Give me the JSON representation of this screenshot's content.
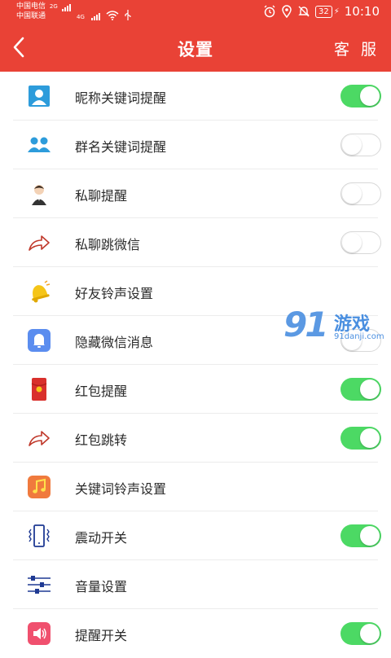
{
  "status": {
    "carrier1": "中国电信",
    "carrier1_net": "2G",
    "carrier2": "中国联通",
    "carrier2_net": "4G",
    "battery": "32",
    "time": "10:10"
  },
  "header": {
    "title": "设置",
    "service_label": "客 服"
  },
  "watermark": {
    "brand": "91",
    "brand_cn": "游戏",
    "url": "91danji.com"
  },
  "items": [
    {
      "label": "昵称关键词提醒",
      "icon": "person-icon",
      "toggle": "on"
    },
    {
      "label": "群名关键词提醒",
      "icon": "group-icon",
      "toggle": "off"
    },
    {
      "label": "私聊提醒",
      "icon": "private-chat-icon",
      "toggle": "off"
    },
    {
      "label": "私聊跳微信",
      "icon": "share-arrow-icon",
      "toggle": "off"
    },
    {
      "label": "好友铃声设置",
      "icon": "bell-icon",
      "toggle": null
    },
    {
      "label": "隐藏微信消息",
      "icon": "notification-bell-icon",
      "toggle": "off"
    },
    {
      "label": "红包提醒",
      "icon": "red-packet-icon",
      "toggle": "on"
    },
    {
      "label": "红包跳转",
      "icon": "share-arrow-icon",
      "toggle": "on"
    },
    {
      "label": "关键词铃声设置",
      "icon": "music-icon",
      "toggle": null
    },
    {
      "label": "震动开关",
      "icon": "vibrate-icon",
      "toggle": "on"
    },
    {
      "label": "音量设置",
      "icon": "volume-sliders-icon",
      "toggle": null
    },
    {
      "label": "提醒开关",
      "icon": "speaker-icon",
      "toggle": "on"
    }
  ],
  "colors": {
    "accent": "#e94236",
    "toggle_on": "#4cd964",
    "icon_blue": "#2d9cdb"
  }
}
